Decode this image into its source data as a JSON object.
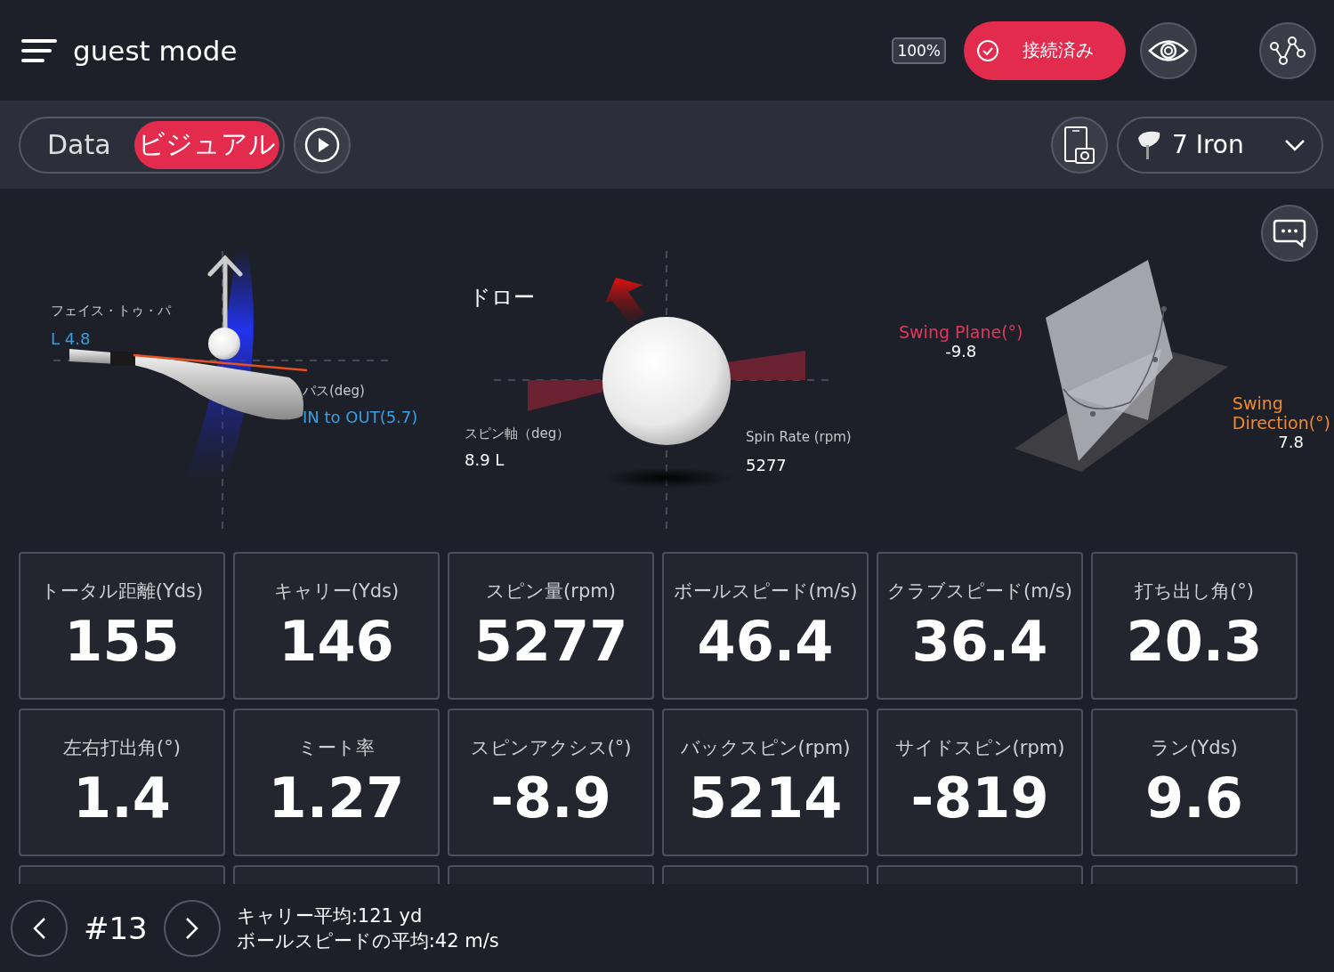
{
  "header": {
    "title": "guest mode",
    "battery": "100%",
    "connection": "接続済み"
  },
  "toolbar": {
    "modes": [
      {
        "label": "Data",
        "selected": false
      },
      {
        "label": "ビジュアル",
        "selected": true
      }
    ],
    "club": "7 Iron"
  },
  "visual": {
    "face": {
      "label": "フェイス・トゥ・パ",
      "value": "L 4.8"
    },
    "path": {
      "label": "パス(deg)",
      "value": "IN to OUT(5.7)"
    },
    "shot_shape": "ドロー",
    "spin_axis": {
      "label": "スピン軸（deg）",
      "value": "8.9 L"
    },
    "spin_rate": {
      "label": "Spin Rate (rpm)",
      "value": "5277"
    },
    "swing_plane": {
      "label": "Swing Plane(°)",
      "value": "-9.8"
    },
    "swing_direction": {
      "label": "Swing Direction(°)",
      "value": "7.8"
    }
  },
  "metrics": [
    {
      "label": "トータル距離(Yds)",
      "value": "155"
    },
    {
      "label": "キャリー(Yds)",
      "value": "146"
    },
    {
      "label": "スピン量(rpm)",
      "value": "5277"
    },
    {
      "label": "ボールスピード(m/s)",
      "value": "46.4"
    },
    {
      "label": "クラブスピード(m/s)",
      "value": "36.4"
    },
    {
      "label": "打ち出し角(°)",
      "value": "20.3"
    },
    {
      "label": "左右打出角(°)",
      "value": "1.4"
    },
    {
      "label": "ミート率",
      "value": "1.27"
    },
    {
      "label": "スピンアクシス(°)",
      "value": "-8.9"
    },
    {
      "label": "バックスピン(rpm)",
      "value": "5214"
    },
    {
      "label": "サイドスピン(rpm)",
      "value": "-819"
    },
    {
      "label": "ラン(Yds)",
      "value": "9.6"
    }
  ],
  "footer": {
    "shot": "#13",
    "summary": [
      "キャリー平均:121 yd",
      "ボールスピードの平均:42 m/s"
    ]
  }
}
